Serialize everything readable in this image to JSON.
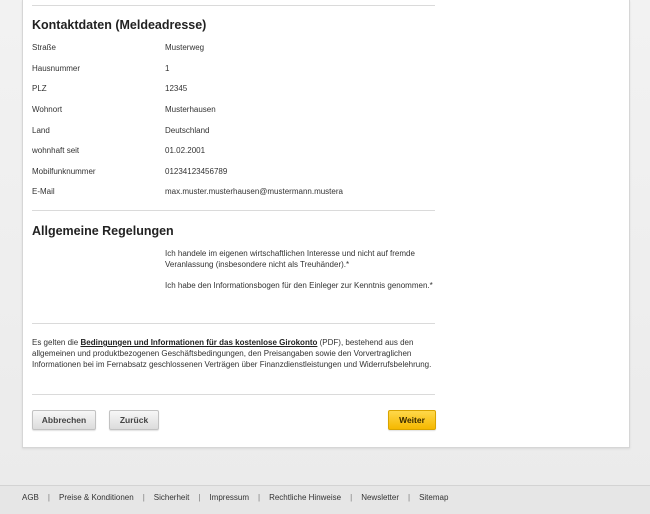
{
  "contact": {
    "title": "Kontaktdaten (Meldeadresse)",
    "rows": [
      {
        "label": "Straße",
        "value": "Musterweg"
      },
      {
        "label": "Hausnummer",
        "value": "1"
      },
      {
        "label": "PLZ",
        "value": "12345"
      },
      {
        "label": "Wohnort",
        "value": "Musterhausen"
      },
      {
        "label": "Land",
        "value": "Deutschland"
      },
      {
        "label": "wohnhaft seit",
        "value": "01.02.2001"
      },
      {
        "label": "Mobilfunknummer",
        "value": "01234123456789"
      },
      {
        "label": "E-Mail",
        "value": "max.muster.musterhausen@mustermann.mustera"
      }
    ]
  },
  "general": {
    "title": "Allgemeine Regelungen",
    "declaration_1": "Ich handele im eigenen wirtschaftlichen Interesse und nicht auf fremde Veranlassung (insbesondere nicht als Treuhänder).*",
    "declaration_2": "Ich habe den Informationsbogen für den Einleger zur Kenntnis genommen.*"
  },
  "terms": {
    "prefix": "Es gelten die ",
    "link": "Bedingungen und Informationen für das kostenlose Girokonto",
    "suffix": " (PDF), bestehend aus den allgemeinen und produktbezogenen Geschäftsbedingungen, den Preisangaben sowie den Vorvertraglichen Informationen bei im Fernabsatz geschlossenen Verträgen über Finanzdienstleistungen und Widerrufsbelehrung."
  },
  "buttons": {
    "cancel": "Abbrechen",
    "back": "Zurück",
    "next": "Weiter"
  },
  "footer": {
    "links": [
      "AGB",
      "Preise & Konditionen",
      "Sicherheit",
      "Impressum",
      "Rechtliche Hinweise",
      "Newsletter",
      "Sitemap"
    ]
  },
  "colors": {
    "primary_button": "#f5b800",
    "background": "#e4e4e4"
  }
}
